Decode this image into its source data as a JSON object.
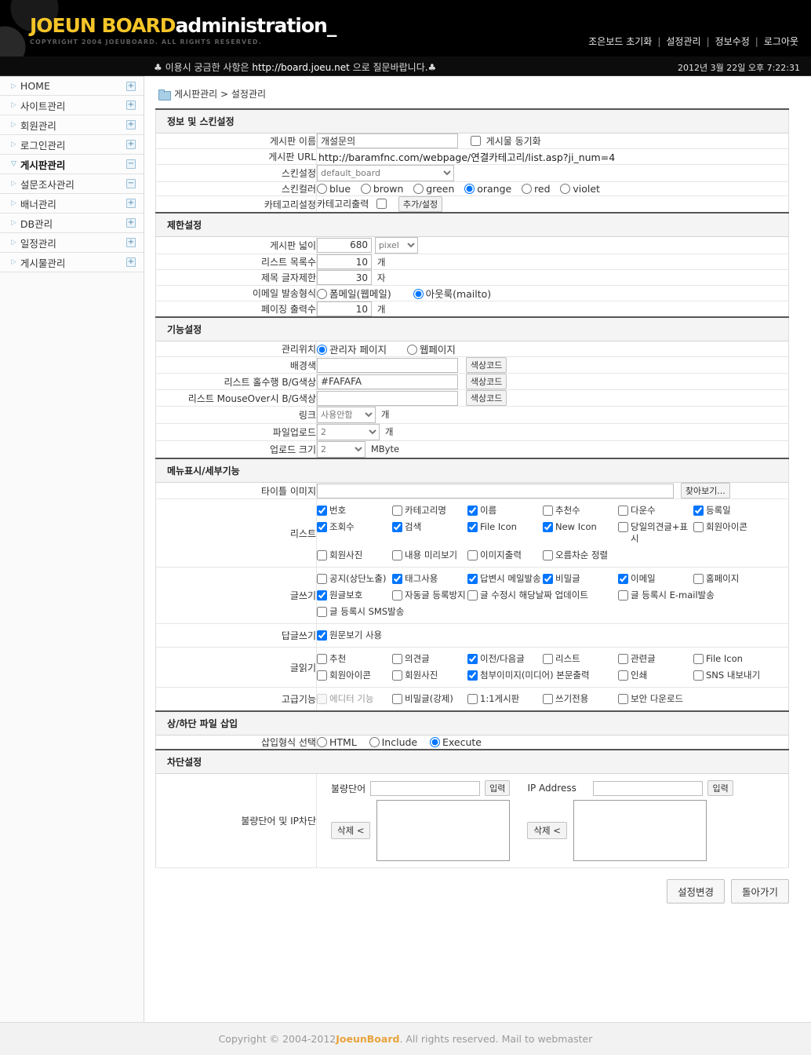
{
  "header": {
    "logo_primary": "JOEUN BOARD",
    "logo_secondary": "administration_",
    "logo_copyright": "COPYRIGHT 2004 JOEUBOARD. ALL RIGHTS RESERVED.",
    "nav": [
      {
        "label": "조은보드 초기화"
      },
      {
        "label": "설정관리"
      },
      {
        "label": "정보수정"
      },
      {
        "label": "로그아웃"
      }
    ],
    "separator": "|"
  },
  "notice": {
    "prefix": "♣ 이용시 궁금한 사항은 ",
    "url": "http://board.joeu.net",
    "suffix": " 으로 질문바랍니다.♣",
    "datetime": "2012년 3월 22일 오후 7:22:31"
  },
  "sidebar": {
    "items": [
      {
        "label": "HOME",
        "toggle": "+",
        "active": false
      },
      {
        "label": "사이트관리",
        "toggle": "+",
        "active": false
      },
      {
        "label": "회원관리",
        "toggle": "+",
        "active": false
      },
      {
        "label": "로그인관리",
        "toggle": "+",
        "active": false
      },
      {
        "label": "게시판관리",
        "toggle": "−",
        "active": true
      },
      {
        "label": "설문조사관리",
        "toggle": "−",
        "active": false
      },
      {
        "label": "배너관리",
        "toggle": "+",
        "active": false
      },
      {
        "label": "DB관리",
        "toggle": "+",
        "active": false
      },
      {
        "label": "일정관리",
        "toggle": "+",
        "active": false
      },
      {
        "label": "게시물관리",
        "toggle": "+",
        "active": false
      }
    ]
  },
  "breadcrumb": {
    "text": "게시판관리  > 설정관리"
  },
  "sections": {
    "info_skin": {
      "title": "정보 및 스킨설정",
      "board_name": {
        "label": "게시판 이름",
        "value": "개설문의",
        "sync_label": "게시물 동기화",
        "sync_checked": false
      },
      "board_url": {
        "label": "게시판 URL",
        "value": "http://baramfnc.com/webpage/연결카테고리/list.asp?ji_num=4"
      },
      "skin": {
        "label": "스킨설정",
        "value": "default_board"
      },
      "skin_color": {
        "label": "스킨컬러",
        "options": [
          "blue",
          "brown",
          "green",
          "orange",
          "red",
          "violet"
        ],
        "selected": "orange"
      },
      "category": {
        "label": "카테고리설정",
        "checkbox_label": "카테고리출력",
        "checked": false,
        "button": "추가/설정"
      }
    },
    "limits": {
      "title": "제한설정",
      "width": {
        "label": "게시판 넓이",
        "value": "680",
        "unit": "pixel"
      },
      "list_count": {
        "label": "리스트 목록수",
        "value": "10",
        "unit": "개"
      },
      "title_limit": {
        "label": "제목 글자제한",
        "value": "30",
        "unit": "자"
      },
      "mail_type": {
        "label": "이메일 발송형식",
        "options": [
          "폼메일(웹메일)",
          "아웃룩(mailto)"
        ],
        "selected": "아웃룩(mailto)"
      },
      "paging": {
        "label": "페이징 출력수",
        "value": "10",
        "unit": "개"
      }
    },
    "features": {
      "title": "기능설정",
      "admin_pos": {
        "label": "관리위치",
        "options": [
          "관리자 페이지",
          "웹페이지"
        ],
        "selected": "관리자 페이지"
      },
      "bgcolor": {
        "label": "배경색",
        "value": "",
        "button": "색상코드"
      },
      "odd_row_bg": {
        "label": "리스트 홀수행 B/G색상",
        "value": "#FAFAFA",
        "button": "색상코드"
      },
      "mouseover_bg": {
        "label": "리스트 MouseOver시 B/G색상",
        "value": "",
        "button": "색상코드"
      },
      "link": {
        "label": "링크",
        "value": "사용안함",
        "unit": "개"
      },
      "file_upload": {
        "label": "파일업로드",
        "value": "2",
        "unit": "개"
      },
      "upload_size": {
        "label": "업로드 크기",
        "value": "2",
        "unit": "MByte"
      }
    },
    "menu_detail": {
      "title": "메뉴표시/세부기능",
      "title_image": {
        "label": "타이틀 이미지",
        "value": "",
        "button": "찾아보기..."
      },
      "list": {
        "label": "리스트",
        "items": [
          {
            "label": "번호",
            "checked": true
          },
          {
            "label": "카테고리명",
            "checked": false
          },
          {
            "label": "이름",
            "checked": true
          },
          {
            "label": "추천수",
            "checked": false
          },
          {
            "label": "다운수",
            "checked": false
          },
          {
            "label": "등록일",
            "checked": true
          },
          {
            "label": "조회수",
            "checked": true
          },
          {
            "label": "검색",
            "checked": true
          },
          {
            "label": "File Icon",
            "checked": true
          },
          {
            "label": "New Icon",
            "checked": true
          },
          {
            "label": "당일의견글+표시",
            "checked": false
          },
          {
            "label": "회원아이콘",
            "checked": false
          },
          {
            "label": "회원사진",
            "checked": false
          },
          {
            "label": "내용 미리보기",
            "checked": false
          },
          {
            "label": "이미지출력",
            "checked": false
          },
          {
            "label": "오름차순 정렬",
            "checked": false
          }
        ]
      },
      "write": {
        "label": "글쓰기",
        "items": [
          {
            "label": "공지(상단노출)",
            "checked": false
          },
          {
            "label": "태그사용",
            "checked": true
          },
          {
            "label": "답변시 메일발송",
            "checked": true
          },
          {
            "label": "비밀글",
            "checked": true
          },
          {
            "label": "이메일",
            "checked": true
          },
          {
            "label": "홈페이지",
            "checked": false
          },
          {
            "label": "원글보호",
            "checked": true
          },
          {
            "label": "자동글 등록방지",
            "checked": false
          },
          {
            "label": "글 수정시 해당날짜 업데이트",
            "checked": false
          },
          {
            "label": "글 등록시 E-mail발송",
            "checked": false
          },
          {
            "label": "글 등록시 SMS발송",
            "checked": false
          }
        ]
      },
      "reply": {
        "label": "답글쓰기",
        "items": [
          {
            "label": "원문보기 사용",
            "checked": true
          }
        ]
      },
      "read": {
        "label": "글읽기",
        "items": [
          {
            "label": "추천",
            "checked": false
          },
          {
            "label": "의견글",
            "checked": false
          },
          {
            "label": "이전/다음글",
            "checked": true
          },
          {
            "label": "리스트",
            "checked": false
          },
          {
            "label": "관련글",
            "checked": false
          },
          {
            "label": "File Icon",
            "checked": false
          },
          {
            "label": "회원아이콘",
            "checked": false
          },
          {
            "label": "회원사진",
            "checked": false
          },
          {
            "label": "첨부이미지(미디어) 본문출력",
            "checked": true
          },
          {
            "label": "인쇄",
            "checked": false
          },
          {
            "label": "SNS 내보내기",
            "checked": false
          }
        ]
      },
      "advanced": {
        "label": "고급기능",
        "items": [
          {
            "label": "에디터 기능",
            "checked": false,
            "disabled": true
          },
          {
            "label": "비밀글(강제)",
            "checked": false
          },
          {
            "label": "1:1게시판",
            "checked": false
          },
          {
            "label": "쓰기전용",
            "checked": false
          },
          {
            "label": "보안 다운로드",
            "checked": false
          }
        ]
      }
    },
    "file_insert": {
      "title": "상/하단 파일 삽입",
      "insert_type": {
        "label": "삽입형식 선택",
        "options": [
          "HTML",
          "Include",
          "Execute"
        ],
        "selected": "Execute"
      }
    },
    "blocking": {
      "title": "차단설정",
      "row_label": "불량단어 및 IP차단",
      "word": {
        "label": "불량단어",
        "value": "",
        "add_button": "입력",
        "del_button": "삭제 <",
        "list_value": ""
      },
      "ip": {
        "label": "IP Address",
        "value": "",
        "add_button": "입력",
        "del_button": "삭제 <",
        "list_value": ""
      }
    }
  },
  "actions": {
    "save": "설정변경",
    "back": "돌아가기"
  },
  "footer": {
    "prefix": "Copyright © 2004-2012 ",
    "brand": "JoeunBoard",
    "suffix": ". All rights reserved. Mail to webmaster"
  }
}
